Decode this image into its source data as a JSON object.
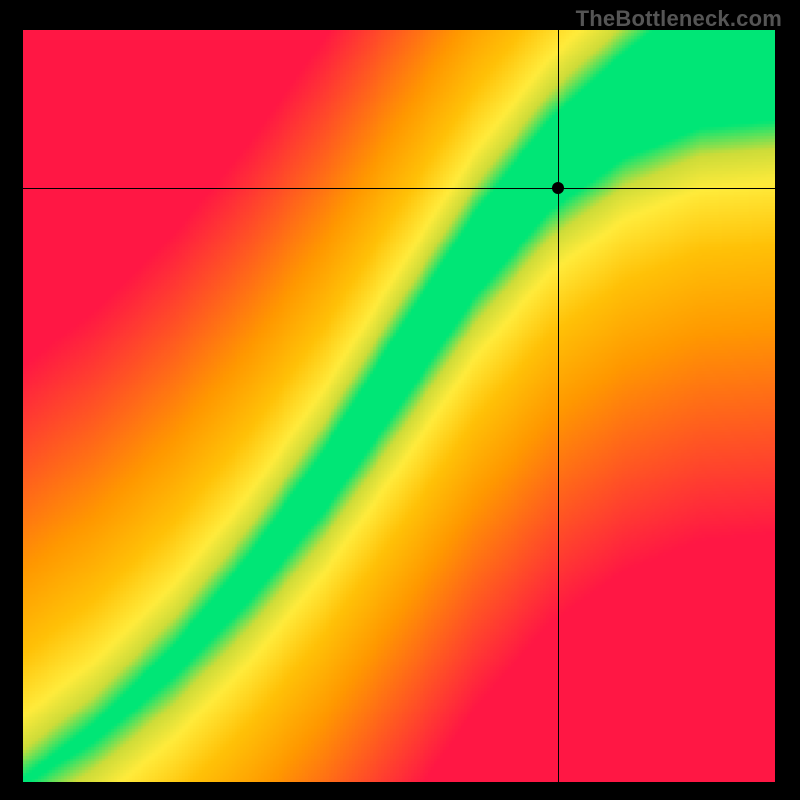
{
  "watermark": "TheBottleneck.com",
  "chart_data": {
    "type": "heatmap",
    "title": "",
    "xlabel": "",
    "ylabel": "",
    "xlim": [
      0,
      1
    ],
    "ylim": [
      0,
      1
    ],
    "grid_resolution": 256,
    "ridge": {
      "description": "Green optimal band running from bottom-left to top-right; red = worst, yellow = intermediate",
      "control_x": [
        0.0,
        0.1,
        0.2,
        0.3,
        0.4,
        0.5,
        0.6,
        0.7,
        0.8,
        0.9,
        1.0
      ],
      "control_y": [
        0.0,
        0.07,
        0.16,
        0.27,
        0.4,
        0.55,
        0.7,
        0.82,
        0.9,
        0.96,
        1.0
      ],
      "half_width": [
        0.005,
        0.012,
        0.02,
        0.03,
        0.04,
        0.05,
        0.055,
        0.06,
        0.07,
        0.09,
        0.12
      ]
    },
    "color_stops": [
      {
        "t": 0.0,
        "color": "#ff1744"
      },
      {
        "t": 0.25,
        "color": "#ff5722"
      },
      {
        "t": 0.5,
        "color": "#ff9800"
      },
      {
        "t": 0.7,
        "color": "#ffc107"
      },
      {
        "t": 0.85,
        "color": "#ffeb3b"
      },
      {
        "t": 0.93,
        "color": "#cddc39"
      },
      {
        "t": 1.0,
        "color": "#00e676"
      }
    ],
    "crosshair": {
      "x": 0.712,
      "y": 0.79
    },
    "marker": {
      "x": 0.712,
      "y": 0.79
    }
  }
}
